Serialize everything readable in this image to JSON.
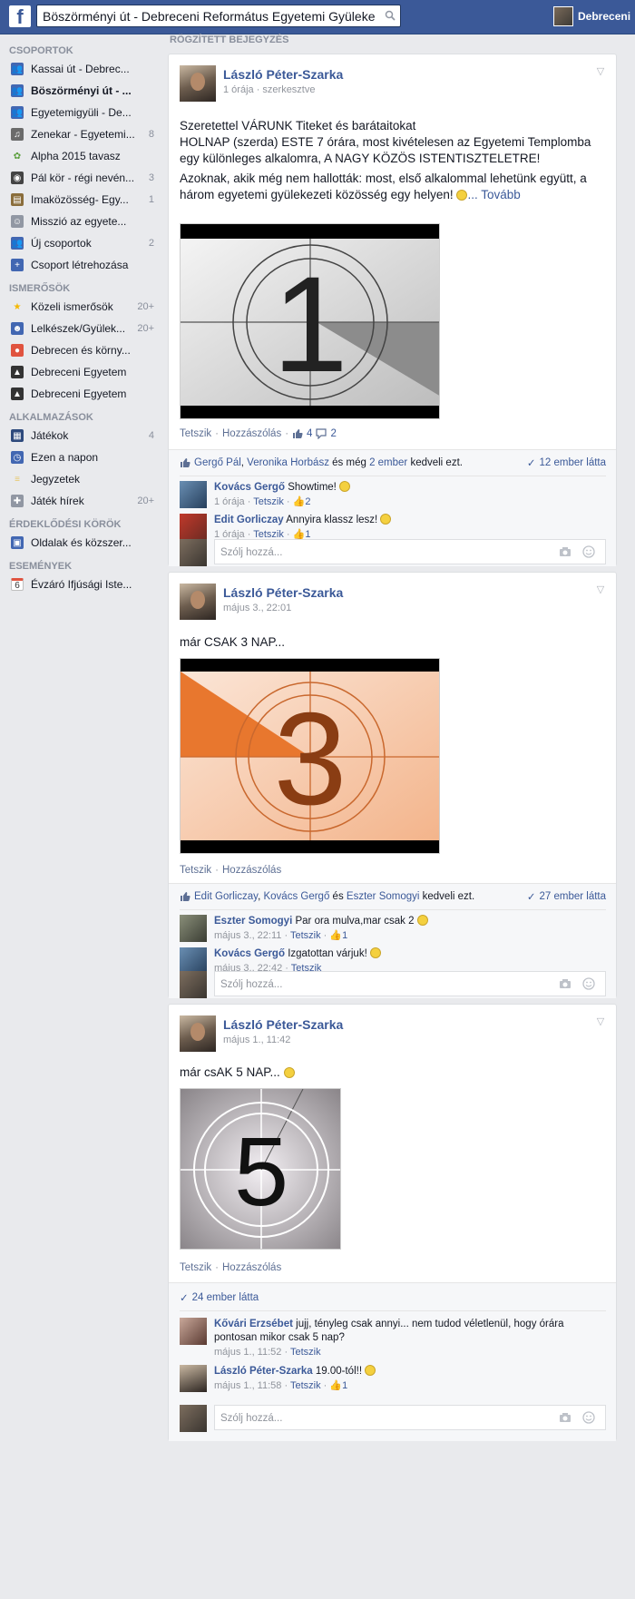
{
  "topbar": {
    "logo": "f",
    "search_value": "Böszörményi út - Debreceni Református Egyetemi Gyüleke",
    "profile_name": "Debreceni"
  },
  "sidebar": {
    "groups_title": "CSOPORTOK",
    "groups": [
      {
        "label": "Kassai út - Debrec...",
        "count": "",
        "icon": "group-icon"
      },
      {
        "label": "Böszörményi út - ...",
        "count": "",
        "icon": "group-icon",
        "active": true
      },
      {
        "label": "Egyetemigyüli - De...",
        "count": "",
        "icon": "group-icon"
      },
      {
        "label": "Zenekar - Egyetemi...",
        "count": "8",
        "icon": "music-icon"
      },
      {
        "label": "Alpha 2015 tavasz",
        "count": "",
        "icon": "plant-icon"
      },
      {
        "label": "Pál kör - régi nevén...",
        "count": "3",
        "icon": "camera-icon"
      },
      {
        "label": "Imaközösség- Egy...",
        "count": "1",
        "icon": "book-icon"
      },
      {
        "label": "Misszió az egyete...",
        "count": "",
        "icon": "theater-icon"
      },
      {
        "label": "Új csoportok",
        "count": "2",
        "icon": "group-icon"
      },
      {
        "label": "Csoport létrehozása",
        "count": "",
        "icon": "plus-icon"
      }
    ],
    "friends_title": "ISMERŐSÖK",
    "friends": [
      {
        "label": "Közeli ismerősök",
        "count": "20+",
        "icon": "star-icon"
      },
      {
        "label": "Lelkészek/Gyülek...",
        "count": "20+",
        "icon": "friends-icon"
      },
      {
        "label": "Debrecen és körny...",
        "count": "",
        "icon": "location-icon"
      },
      {
        "label": "Debreceni Egyetem",
        "count": "",
        "icon": "graduation-icon"
      },
      {
        "label": "Debreceni Egyetem",
        "count": "",
        "icon": "graduation-icon"
      }
    ],
    "apps_title": "ALKALMAZÁSOK",
    "apps": [
      {
        "label": "Játékok",
        "count": "4",
        "icon": "games-icon"
      },
      {
        "label": "Ezen a napon",
        "count": "",
        "icon": "clock-icon"
      },
      {
        "label": "Jegyzetek",
        "count": "",
        "icon": "notes-icon"
      },
      {
        "label": "Játék hírek",
        "count": "20+",
        "icon": "controller-icon"
      }
    ],
    "interests_title": "ÉRDEKLŐDÉSI KÖRÖK",
    "interests": [
      {
        "label": "Oldalak és közszer...",
        "count": "",
        "icon": "pages-icon"
      }
    ],
    "events_title": "ESEMÉNYEK",
    "events": [
      {
        "label": "Évzáró Ifjúsági Iste...",
        "count": "",
        "icon": "calendar-icon",
        "day": "6"
      }
    ]
  },
  "feed": {
    "pinned_label": "RÖGZÍTETT BEJEGYZÉS",
    "comment_placeholder": "Szólj hozzá...",
    "like_label": "Tetszik",
    "comment_label": "Hozzászólás",
    "posts": [
      {
        "author": "László Péter-Szarka",
        "meta": "1 órája · szerkesztve",
        "p1": "Szeretettel VÁRUNK Titeket és barátaitokat\nHOLNAP (szerda) ESTE 7 órára, most kivételesen az Egyetemi Templomba\negy különleges alkalomra, A NAGY KÖZÖS ISTENTISZTELETRE!",
        "p2": "Azoknak, akik még nem hallották: most, első alkalommal lehetünk együtt, a három egyetemi gyülekezeti közösség egy helyen!",
        "more": "... Tovább",
        "number": "1",
        "like_count": "4",
        "comment_count": "2",
        "likers_a": "Gergő Pál",
        "likers_sep": ", ",
        "likers_b": "Veronika Horbász",
        "likers_and": " és még ",
        "likers_c": "2 ember",
        "likers_end": " kedveli ezt.",
        "seen": "12 ember látta",
        "comments": [
          {
            "name": "Kovács Gergő",
            "text": "Showtime!",
            "time": "1 órája",
            "likes": "2"
          },
          {
            "name": "Edit Gorliczay",
            "text": "Annyira klassz lesz!",
            "time": "1 órája",
            "likes": "1"
          }
        ]
      },
      {
        "author": "László Péter-Szarka",
        "meta": "május 3., 22:01",
        "text": "már CSAK 3 NAP...",
        "number": "3",
        "likers_a": "Edit Gorliczay",
        "likers_sep": ", ",
        "likers_b": "Kovács Gergő",
        "likers_and": " és ",
        "likers_c": "Eszter Somogyi",
        "likers_end": " kedveli ezt.",
        "seen": "27 ember látta",
        "comments": [
          {
            "name": "Eszter Somogyi",
            "text": "Par ora mulva,mar csak 2",
            "time": "május 3., 22:11",
            "likes": "1"
          },
          {
            "name": "Kovács Gergő",
            "text": "Izgatottan várjuk!",
            "time": "május 3., 22:42",
            "likes": ""
          }
        ]
      },
      {
        "author": "László Péter-Szarka",
        "meta": "május 1., 11:42",
        "text": "már csAK 5 NAP...",
        "number": "5",
        "seen": "24 ember látta",
        "comments": [
          {
            "name": "Kővári Erzsébet",
            "text": "jujj, tényleg csak annyi... nem tudod véletlenül, hogy órára pontosan mikor csak 5 nap?",
            "time": "május 1., 11:52",
            "likes": ""
          },
          {
            "name": "László Péter-Szarka",
            "text": "19.00-tól!!",
            "time": "május 1., 11:58",
            "likes": "1"
          }
        ]
      }
    ]
  }
}
